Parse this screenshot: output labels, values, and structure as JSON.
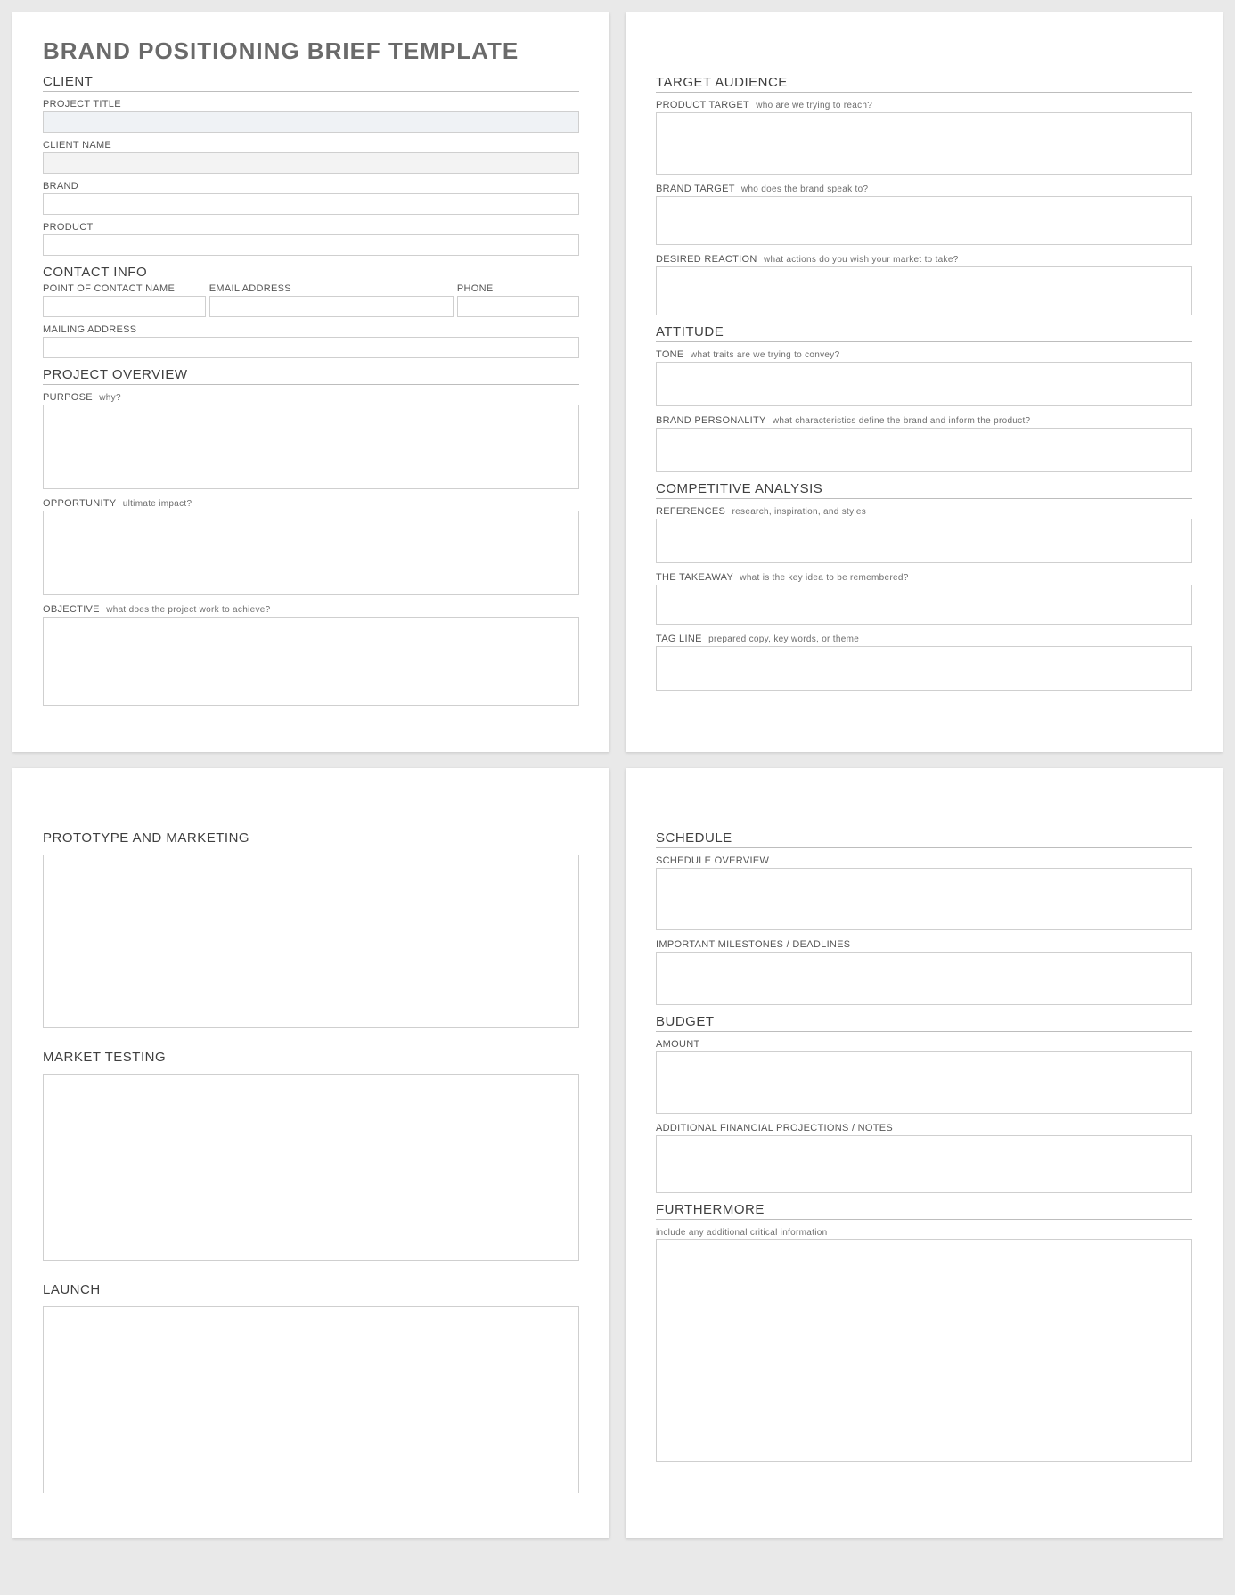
{
  "doc_title": "BRAND POSITIONING BRIEF TEMPLATE",
  "page1_left": {
    "client": {
      "header": "CLIENT",
      "project_title": "PROJECT TITLE",
      "client_name": "CLIENT NAME",
      "brand": "BRAND",
      "product": "PRODUCT"
    },
    "contact": {
      "header": "CONTACT INFO",
      "poc": "POINT OF CONTACT NAME",
      "email": "EMAIL ADDRESS",
      "phone": "PHONE",
      "mailing": "MAILING ADDRESS"
    },
    "overview": {
      "header": "PROJECT OVERVIEW",
      "purpose_label": "PURPOSE",
      "purpose_hint": "why?",
      "opportunity_label": "OPPORTUNITY",
      "opportunity_hint": "ultimate impact?",
      "objective_label": "OBJECTIVE",
      "objective_hint": "what does the project work to achieve?"
    }
  },
  "page1_right": {
    "audience": {
      "header": "TARGET AUDIENCE",
      "product_target_label": "PRODUCT TARGET",
      "product_target_hint": "who are we trying to reach?",
      "brand_target_label": "BRAND TARGET",
      "brand_target_hint": "who does the brand speak to?",
      "desired_label": "DESIRED REACTION",
      "desired_hint": "what actions do you wish your market to take?"
    },
    "attitude": {
      "header": "ATTITUDE",
      "tone_label": "TONE",
      "tone_hint": "what traits are we trying to convey?",
      "personality_label": "BRAND PERSONALITY",
      "personality_hint": "what characteristics define the brand and inform the product?"
    },
    "competitive": {
      "header": "COMPETITIVE ANALYSIS",
      "references_label": "REFERENCES",
      "references_hint": "research, inspiration, and styles",
      "takeaway_label": "THE TAKEAWAY",
      "takeaway_hint": "what is the key idea to be remembered?",
      "tagline_label": "TAG LINE",
      "tagline_hint": "prepared copy, key words, or theme"
    }
  },
  "page2_left": {
    "prototype_header": "PROTOTYPE AND MARKETING",
    "market_testing_header": "MARKET TESTING",
    "launch_header": "LAUNCH"
  },
  "page2_right": {
    "schedule": {
      "header": "SCHEDULE",
      "overview": "SCHEDULE OVERVIEW",
      "milestones": "IMPORTANT MILESTONES / DEADLINES"
    },
    "budget": {
      "header": "BUDGET",
      "amount": "AMOUNT",
      "notes": "ADDITIONAL FINANCIAL PROJECTIONS / NOTES"
    },
    "furthermore": {
      "header": "FURTHERMORE",
      "hint": "include any additional critical information"
    }
  }
}
